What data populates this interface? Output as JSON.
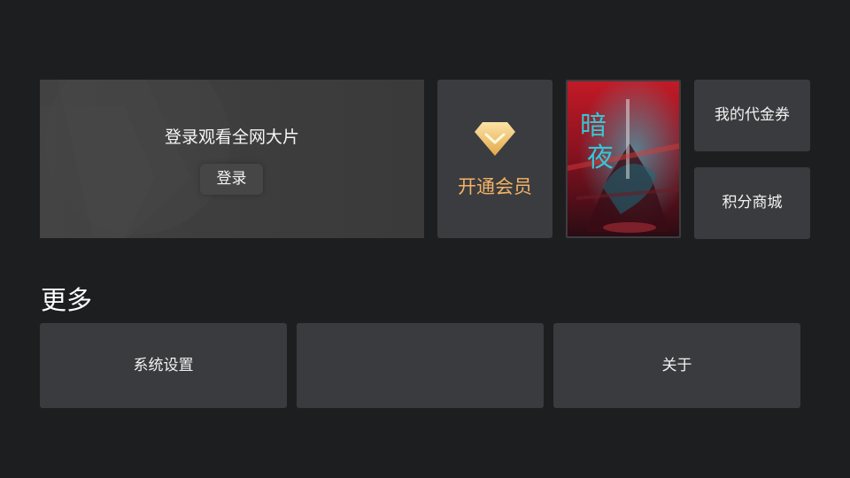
{
  "login": {
    "title": "登录观看全网大片",
    "button_label": "登录"
  },
  "vip": {
    "label": "开通会员",
    "icon": "diamond-icon",
    "accent_color": "#f3b266"
  },
  "poster": {
    "title_glyphs": "暗夜",
    "dominant_color": "#c8202a"
  },
  "side_cards": [
    {
      "label": "我的代金券"
    },
    {
      "label": "积分商城"
    }
  ],
  "more": {
    "section_title": "更多",
    "items": [
      {
        "label": "系统设置"
      },
      {
        "label": ""
      },
      {
        "label": "关于"
      }
    ]
  }
}
